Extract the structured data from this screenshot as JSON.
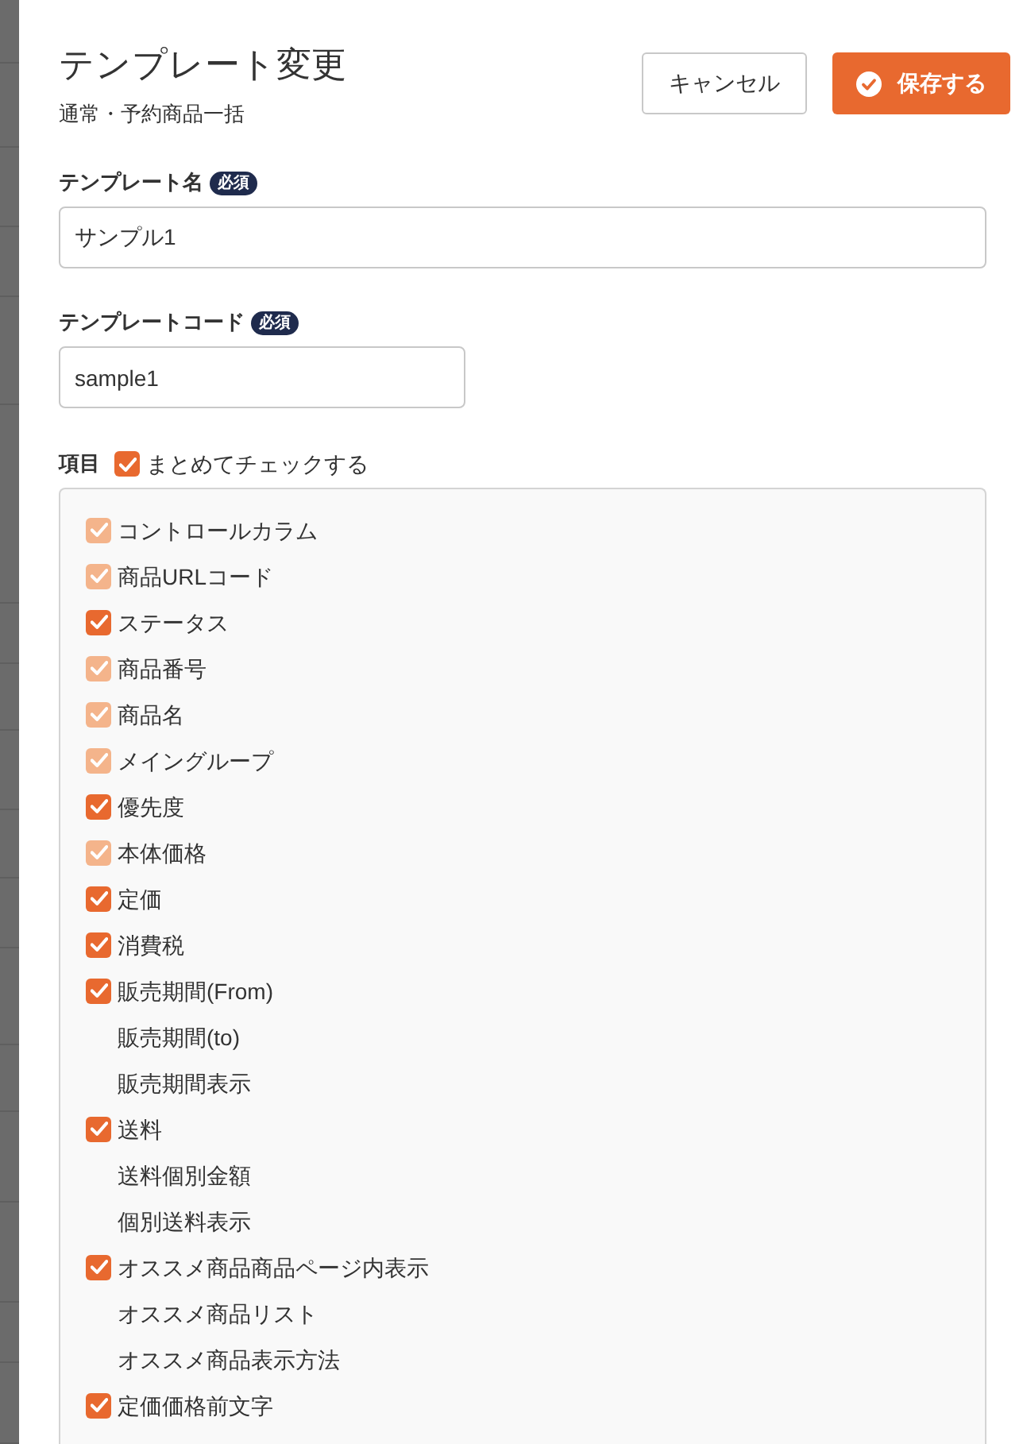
{
  "header": {
    "title": "テンプレート変更",
    "subtitle": "通常・予約商品一括"
  },
  "buttons": {
    "cancel": "キャンセル",
    "save": "保存する"
  },
  "fields": {
    "template_name": {
      "label": "テンプレート名",
      "badge": "必須",
      "value": "サンプル1"
    },
    "template_code": {
      "label": "テンプレートコード",
      "badge": "必須",
      "value": "sample1"
    }
  },
  "items_section": {
    "label": "項目",
    "check_all": {
      "label": "まとめてチェックする",
      "checked": true
    },
    "items": [
      {
        "label": "コントロールカラム",
        "checked": true,
        "disabled": true
      },
      {
        "label": "商品URLコード",
        "checked": true,
        "disabled": true
      },
      {
        "label": "ステータス",
        "checked": true,
        "disabled": false
      },
      {
        "label": "商品番号",
        "checked": true,
        "disabled": true
      },
      {
        "label": "商品名",
        "checked": true,
        "disabled": true
      },
      {
        "label": "メイングループ",
        "checked": true,
        "disabled": true
      },
      {
        "label": "優先度",
        "checked": true,
        "disabled": false
      },
      {
        "label": "本体価格",
        "checked": true,
        "disabled": true
      },
      {
        "label": "定価",
        "checked": true,
        "disabled": false
      },
      {
        "label": "消費税",
        "checked": true,
        "disabled": false
      },
      {
        "label": "販売期間(From)",
        "checked": true,
        "disabled": false
      },
      {
        "label": "販売期間(to)",
        "checked": false,
        "disabled": false
      },
      {
        "label": "販売期間表示",
        "checked": false,
        "disabled": false
      },
      {
        "label": "送料",
        "checked": true,
        "disabled": false
      },
      {
        "label": "送料個別金額",
        "checked": false,
        "disabled": false
      },
      {
        "label": "個別送料表示",
        "checked": false,
        "disabled": false
      },
      {
        "label": "オススメ商品商品ページ内表示",
        "checked": true,
        "disabled": false
      },
      {
        "label": "オススメ商品リスト",
        "checked": false,
        "disabled": false
      },
      {
        "label": "オススメ商品表示方法",
        "checked": false,
        "disabled": false
      },
      {
        "label": "定価価格前文字",
        "checked": true,
        "disabled": false
      }
    ]
  }
}
